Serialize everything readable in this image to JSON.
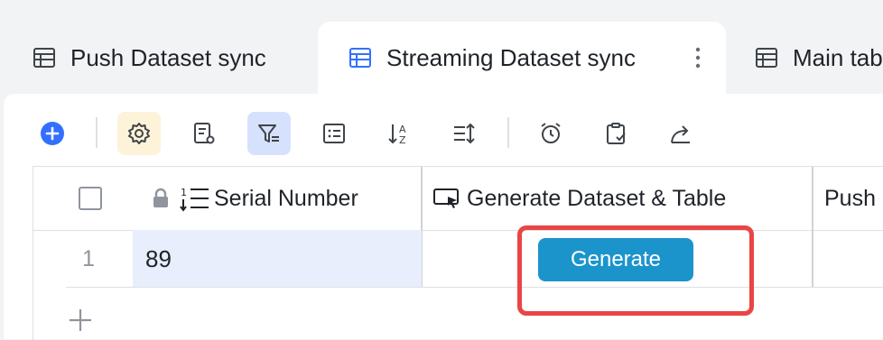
{
  "tabs": [
    {
      "label": "Push Dataset sync",
      "icon": "table-icon"
    },
    {
      "label": "Streaming Dataset sync",
      "icon": "table-icon",
      "active": true
    },
    {
      "label": "Main table",
      "icon": "table-icon"
    }
  ],
  "toolbar": {
    "items": [
      "add-icon",
      "settings-icon",
      "form-settings-icon",
      "filter-icon",
      "list-icon",
      "sort-icon",
      "row-height-icon",
      "alarm-icon",
      "clipboard-check-icon",
      "share-icon"
    ]
  },
  "grid": {
    "columns": [
      {
        "label": "Serial Number",
        "icon": "number-list-icon"
      },
      {
        "label": "Generate Dataset & Table",
        "icon": "button-field-icon"
      },
      {
        "label": "Push"
      }
    ],
    "rows": [
      {
        "index": "1",
        "serial": "89",
        "button_label": "Generate"
      }
    ]
  },
  "colors": {
    "accent": "#3370ff",
    "button": "#1b94cc",
    "highlight": "#e94545",
    "selected_cell": "#e8eefc"
  }
}
